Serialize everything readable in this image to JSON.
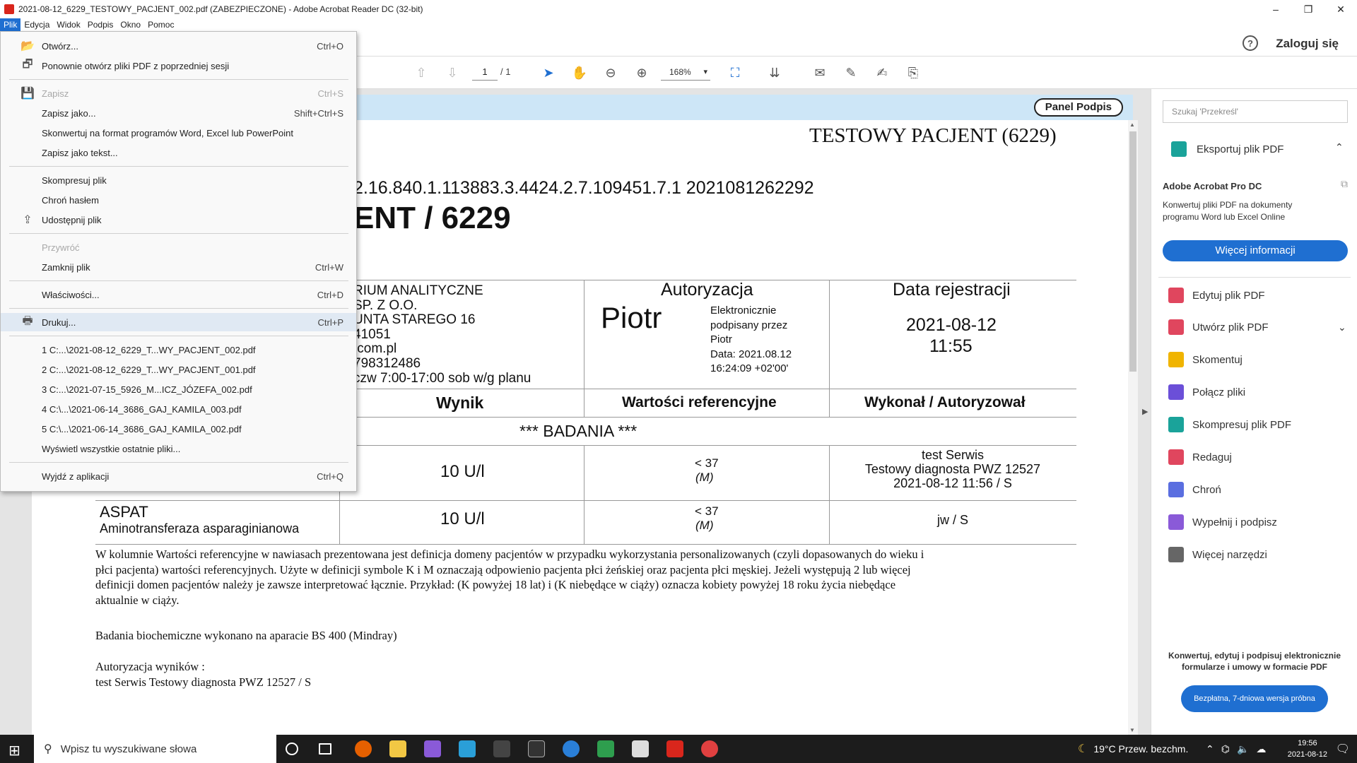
{
  "window": {
    "title": "2021-08-12_6229_TESTOWY_PACJENT_002.pdf (ZABEZPIECZONE) - Adobe Acrobat Reader DC (32-bit)",
    "controls": {
      "minimize": "–",
      "restore": "❐",
      "close": "✕"
    }
  },
  "menubar": [
    "Plik",
    "Edycja",
    "Widok",
    "Podpis",
    "Okno",
    "Pomoc"
  ],
  "appbar": {
    "help": "?",
    "login": "Zaloguj się"
  },
  "toolbar": {
    "page_current": "1",
    "page_total": "/ 1",
    "zoom": "168%"
  },
  "sig_panel_button": "Panel Podpis",
  "document": {
    "patient_header": "TESTOWY PACJENT (6229)",
    "uid": "2.16.840.1.113883.3.4424.2.7.109451.7.1 2021081262292",
    "big_title": "ENT / 6229",
    "lab_lines": [
      "RIUM ANALITYCZNE",
      "SP. Z O.O.",
      "UNTA STAREGO 16",
      "41051",
      ".com.pl",
      "798312486",
      "czw 7:00-17:00 sob w/g planu"
    ],
    "auth_header": "Autoryzacja",
    "auth_name": "Piotr",
    "auth_sig_lines": [
      "Elektronicznie",
      "podpisany przez",
      "Piotr",
      "Data: 2021.08.12",
      "16:24:09 +02'00'"
    ],
    "reg_header": "Data rejestracji",
    "reg_date": "2021-08-12",
    "reg_time": "11:55",
    "col_result": "Wynik",
    "col_ref": "Wartości referencyjne",
    "col_by": "Wykonał / Autoryzował",
    "section": "*** BADANIA ***",
    "rows": [
      {
        "name": "",
        "desc": "",
        "result": "10 U/l",
        "ref": "< 37",
        "ref_sub": "(M)",
        "by_lines": [
          "test Serwis",
          "Testowy diagnosta PWZ 12527",
          "2021-08-12 11:56 / S"
        ]
      },
      {
        "name": "ASPAT",
        "desc": "Aminotransferaza asparaginianowa",
        "result": "10 U/l",
        "ref": "< 37",
        "ref_sub": "(M)",
        "by_lines": [
          "jw / S"
        ]
      }
    ],
    "note_lines": [
      "W kolumnie Wartości referencyjne w nawiasach prezentowana jest definicja domeny pacjentów w przypadku wykorzystania personalizowanych (czyli dopasowanych do wieku i",
      "płci pacjenta) wartości referencyjnych. Użyte w definicji symbole K i M oznaczają odpowienio pacjenta płci żeńskiej oraz pacjenta płci męskiej. Jeżeli występują 2 lub więcej",
      "definicji domen pacjentów należy je zawsze interpretować łącznie. Przykład: (K powyżej 18 lat) i (K niebędące w ciąży) oznacza kobiety powyżej 18 roku życia niebędące",
      "aktualnie w ciąży."
    ],
    "device_note": "Badania biochemiczne wykonano na aparacie BS 400 (Mindray)",
    "auth_results_label": "Autoryzacja wyników :",
    "auth_results_value": "test Serwis Testowy diagnosta PWZ 12527 / S"
  },
  "right_panel": {
    "search_placeholder": "Szukaj 'Przekreśl'",
    "export": "Eksportuj plik PDF",
    "pro_title": "Adobe Acrobat Pro DC",
    "pro_desc": "Konwertuj pliki PDF na dokumenty programu Word lub Excel Online",
    "more_info": "Więcej informacji",
    "tools": [
      {
        "label": "Edytuj plik PDF",
        "color": "#e0465e",
        "icon": "edit-pdf-icon"
      },
      {
        "label": "Utwórz plik PDF",
        "color": "#e0465e",
        "icon": "create-pdf-icon"
      },
      {
        "label": "Skomentuj",
        "color": "#f0b400",
        "icon": "comment-icon"
      },
      {
        "label": "Połącz pliki",
        "color": "#6b4fd8",
        "icon": "combine-icon"
      },
      {
        "label": "Skompresuj plik PDF",
        "color": "#1aa39a",
        "icon": "compress-icon"
      },
      {
        "label": "Redaguj",
        "color": "#e0465e",
        "icon": "redact-icon"
      },
      {
        "label": "Chroń",
        "color": "#5a6ee0",
        "icon": "protect-icon"
      },
      {
        "label": "Wypełnij i podpisz",
        "color": "#8a5ad8",
        "icon": "fill-sign-icon"
      },
      {
        "label": "Więcej narzędzi",
        "color": "#666666",
        "icon": "more-tools-icon"
      }
    ],
    "promo": "Konwertuj, edytuj i podpisuj elektronicznie formularze i umowy w formacie PDF",
    "trial": "Bezpłatna, 7-dniowa wersja próbna"
  },
  "file_menu": {
    "items": [
      {
        "label": "Otwórz...",
        "shortcut": "Ctrl+O",
        "icon": "folder-open-icon",
        "disabled": false
      },
      {
        "label": "Ponownie otwórz pliki PDF z poprzedniej sesji",
        "shortcut": "",
        "icon": "reopen-icon",
        "disabled": false
      },
      {
        "label": "Zapisz",
        "shortcut": "Ctrl+S",
        "icon": "save-icon",
        "disabled": true
      },
      {
        "label": "Zapisz jako...",
        "shortcut": "Shift+Ctrl+S",
        "icon": "",
        "disabled": false
      },
      {
        "label": "Skonwertuj na format programów Word, Excel lub PowerPoint",
        "shortcut": "",
        "icon": "",
        "disabled": false
      },
      {
        "label": "Zapisz jako tekst...",
        "shortcut": "",
        "icon": "",
        "disabled": false
      },
      {
        "label": "Skompresuj plik",
        "shortcut": "",
        "icon": "",
        "disabled": false
      },
      {
        "label": "Chroń hasłem",
        "shortcut": "",
        "icon": "",
        "disabled": false
      },
      {
        "label": "Udostępnij plik",
        "shortcut": "",
        "icon": "share-icon",
        "disabled": false
      },
      {
        "label": "Przywróć",
        "shortcut": "",
        "icon": "",
        "disabled": true
      },
      {
        "label": "Zamknij plik",
        "shortcut": "Ctrl+W",
        "icon": "",
        "disabled": false
      },
      {
        "label": "Właściwości...",
        "shortcut": "Ctrl+D",
        "icon": "",
        "disabled": false
      },
      {
        "label": "Drukuj...",
        "shortcut": "Ctrl+P",
        "icon": "printer-icon",
        "disabled": false
      },
      {
        "label": "1 C:...\\2021-08-12_6229_T...WY_PACJENT_002.pdf",
        "shortcut": "",
        "icon": "",
        "disabled": false
      },
      {
        "label": "2 C:...\\2021-08-12_6229_T...WY_PACJENT_001.pdf",
        "shortcut": "",
        "icon": "",
        "disabled": false
      },
      {
        "label": "3 C:...\\2021-07-15_5926_M...ICZ_JÓZEFA_002.pdf",
        "shortcut": "",
        "icon": "",
        "disabled": false
      },
      {
        "label": "4 C:\\...\\2021-06-14_3686_GAJ_KAMILA_003.pdf",
        "shortcut": "",
        "icon": "",
        "disabled": false
      },
      {
        "label": "5 C:\\...\\2021-06-14_3686_GAJ_KAMILA_002.pdf",
        "shortcut": "",
        "icon": "",
        "disabled": false
      },
      {
        "label": "Wyświetl wszystkie ostatnie pliki...",
        "shortcut": "",
        "icon": "",
        "disabled": false
      },
      {
        "label": "Wyjdź z aplikacji",
        "shortcut": "Ctrl+Q",
        "icon": "",
        "disabled": false
      }
    ]
  },
  "taskbar": {
    "search_placeholder": "Wpisz tu wyszukiwane słowa",
    "weather": "19°C  Przew. bezchm.",
    "time": "19:56",
    "date": "2021-08-12"
  }
}
